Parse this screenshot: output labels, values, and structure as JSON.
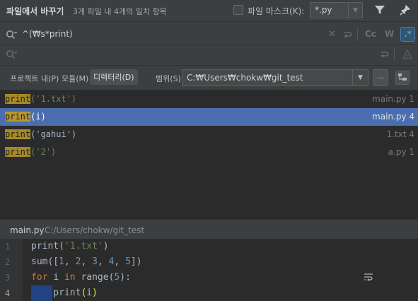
{
  "header": {
    "title": "파일에서 바꾸기",
    "match_count": "3개 파일 내 4개의 일치 항목",
    "file_mask_label": "파일 마스크(K):",
    "file_mask_value": "*.py",
    "icons": [
      "filter-icon",
      "pin-icon"
    ]
  },
  "search": {
    "query": "^(\\s*print)",
    "replace": "",
    "option_labels": [
      "Cc",
      "W",
      ".*"
    ]
  },
  "scope": {
    "project": "프로젝트 내(P)",
    "module": "모듈(M)",
    "directory": "디렉터리(D)",
    "scope": "범위(S)",
    "selected": "디렉터리(D)",
    "directory_path": "C:\\Users\\chokw\\git_test",
    "browse_label": "..."
  },
  "results": [
    {
      "match": "print",
      "rest": "('1.txt')",
      "location": "main.py 1",
      "selected": false
    },
    {
      "match": "print",
      "rest": "(i)",
      "location": "main.py 4",
      "selected": true
    },
    {
      "match": "print",
      "rest": "('gahui')",
      "location": "1.txt 4",
      "selected": false
    },
    {
      "match": "print",
      "rest": "('2')",
      "location": "a.py 1",
      "selected": false
    }
  ],
  "preview": {
    "file": "main.py",
    "path": "C:/Users/chokw/git_test",
    "lines": [
      {
        "num": "1",
        "text": "print('1.txt')"
      },
      {
        "num": "2",
        "text": "sum([1, 2, 3, 4, 5])"
      },
      {
        "num": "3",
        "text": "for i in range(5):"
      },
      {
        "num": "4",
        "text": "    print(i)"
      }
    ]
  },
  "colors": {
    "background": "#3c3f41",
    "editor": "#2b2b2b",
    "selection": "#4b6eaf",
    "match_highlight": "#a68a28",
    "regex_active": "#4a9fd8"
  }
}
